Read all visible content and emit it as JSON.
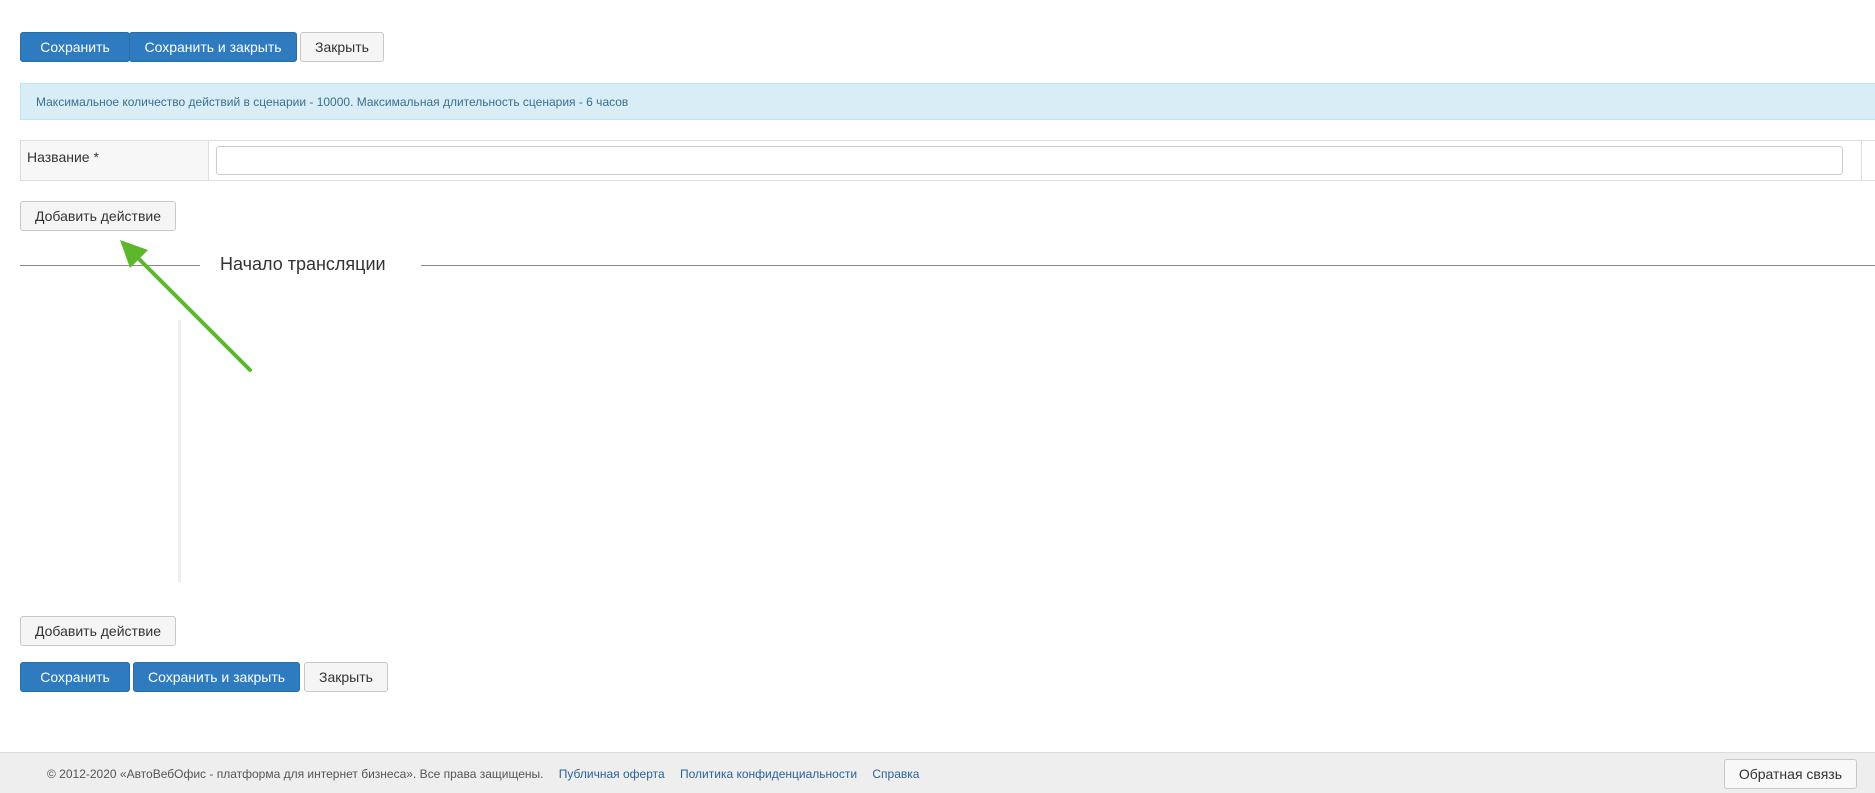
{
  "top_toolbar": {
    "save_label": "Сохранить",
    "save_close_label": "Сохранить и закрыть",
    "close_label": "Закрыть"
  },
  "info": {
    "message": "Максимальное количество действий в сценарии - 10000. Максимальная длительность сценария - 6 часов"
  },
  "form": {
    "name_label": "Название *",
    "name_value": ""
  },
  "add_action_label": "Добавить действие",
  "section": {
    "title": "Начало трансляции"
  },
  "bottom_toolbar": {
    "add_action_label": "Добавить действие",
    "save_label": "Сохранить",
    "save_close_label": "Сохранить и закрыть",
    "close_label": "Закрыть"
  },
  "footer": {
    "copyright": "© 2012-2020 «АвтоВебОфис - платформа для интернет бизнеса». Все права защищены.",
    "links": [
      "Публичная оферта",
      "Политика конфиденциальности",
      "Справка"
    ],
    "feedback_label": "Обратная связь"
  },
  "colors": {
    "primary": "#2e7bbf",
    "info_bg": "#d9edf7",
    "arrow": "#5cb82a"
  }
}
